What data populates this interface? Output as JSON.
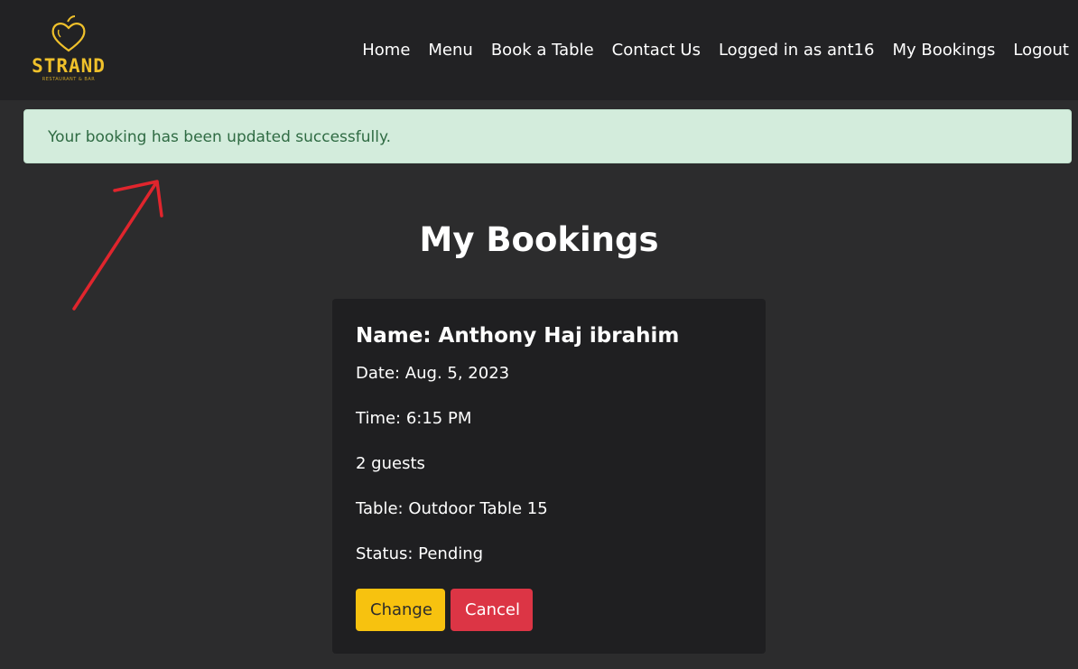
{
  "brand": {
    "name": "STRAND",
    "tagline": "RESTAURANT & BAR",
    "accent_color": "#f0c12b",
    "logo_icon": "apple-heart-icon"
  },
  "nav": {
    "items": [
      {
        "label": "Home"
      },
      {
        "label": "Menu"
      },
      {
        "label": "Book a Table"
      },
      {
        "label": "Contact Us"
      },
      {
        "label": "Logged in as ant16"
      },
      {
        "label": "My Bookings"
      },
      {
        "label": "Logout"
      }
    ]
  },
  "alert": {
    "message": "Your booking has been updated successfully.",
    "color": "#d3ecdc"
  },
  "annotation": {
    "icon": "red-arrow-icon",
    "color": "#e0252d"
  },
  "page": {
    "title": "My Bookings"
  },
  "booking": {
    "name": "Name: Anthony Haj ibrahim",
    "date": "Date: Aug. 5, 2023",
    "time": "Time: 6:15 PM",
    "guests": "2 guests",
    "table": "Table: Outdoor Table 15",
    "status": "Status: Pending",
    "change_label": "Change",
    "cancel_label": "Cancel"
  }
}
